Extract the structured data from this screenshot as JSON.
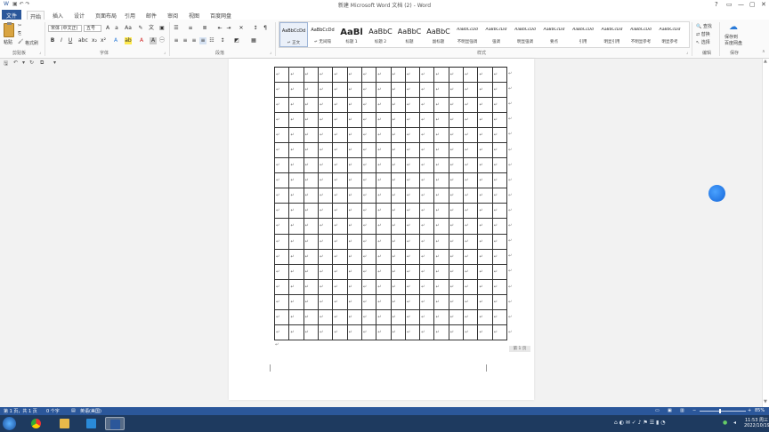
{
  "window": {
    "title": "新建 Microsoft Word 文档 (2) - Word",
    "controls": [
      "?",
      "▢",
      "—",
      "▢",
      "✕"
    ]
  },
  "tabs": [
    "文件",
    "开始",
    "插入",
    "设计",
    "页面布局",
    "引用",
    "邮件",
    "审阅",
    "视图",
    "百度网盘"
  ],
  "ribbon": {
    "clipboard": {
      "paste": "粘贴",
      "cut": "剪切",
      "copy": "复制",
      "format_painter": "格式刷",
      "label": "剪贴板"
    },
    "font": {
      "name": "宋体 (中文正)",
      "size": "五号",
      "label": "字体"
    },
    "paragraph": {
      "label": "段落"
    },
    "styles": {
      "label": "样式",
      "items": [
        {
          "preview": "AaBbCcDd",
          "name": "↵ 正文"
        },
        {
          "preview": "AaBbCcDd",
          "name": "↵ 无间隔"
        },
        {
          "preview": "AaBl",
          "name": "标题 1"
        },
        {
          "preview": "AaBbC",
          "name": "标题 2"
        },
        {
          "preview": "AaBbC",
          "name": "标题"
        },
        {
          "preview": "AaBbC",
          "name": "副标题"
        },
        {
          "preview": "AaBbCcDd",
          "name": "不明显强调"
        },
        {
          "preview": "AaBbCcDd",
          "name": "强调"
        },
        {
          "preview": "AaBbCcDd",
          "name": "明显强调"
        },
        {
          "preview": "AaBbCcDd",
          "name": "要点"
        },
        {
          "preview": "AaBbCcDd",
          "name": "引用"
        },
        {
          "preview": "AaBbCcDd",
          "name": "明显引用"
        },
        {
          "preview": "AaBbCcDd",
          "name": "不明显参考"
        },
        {
          "preview": "AaBbCcDd",
          "name": "明显参考"
        }
      ]
    },
    "editing": {
      "find": "查找",
      "replace": "替换",
      "select": "选择",
      "label": "编辑"
    },
    "save": {
      "line1": "保存到",
      "line2": "百度网盘",
      "label": "保存"
    }
  },
  "document": {
    "rows": 18,
    "cols": 16,
    "cell_mark": "↵",
    "page_number": "第 1 页"
  },
  "statusbar": {
    "page": "第 1 页，共 1 页",
    "words": "0 个字",
    "lang": "英语(美国)",
    "zoom": "85%"
  },
  "taskbar": {
    "time": "11:53 周三",
    "date": "2022/10/19"
  },
  "colors": {
    "word_blue": "#2b579a",
    "taskbar": "#1e3a5f"
  }
}
